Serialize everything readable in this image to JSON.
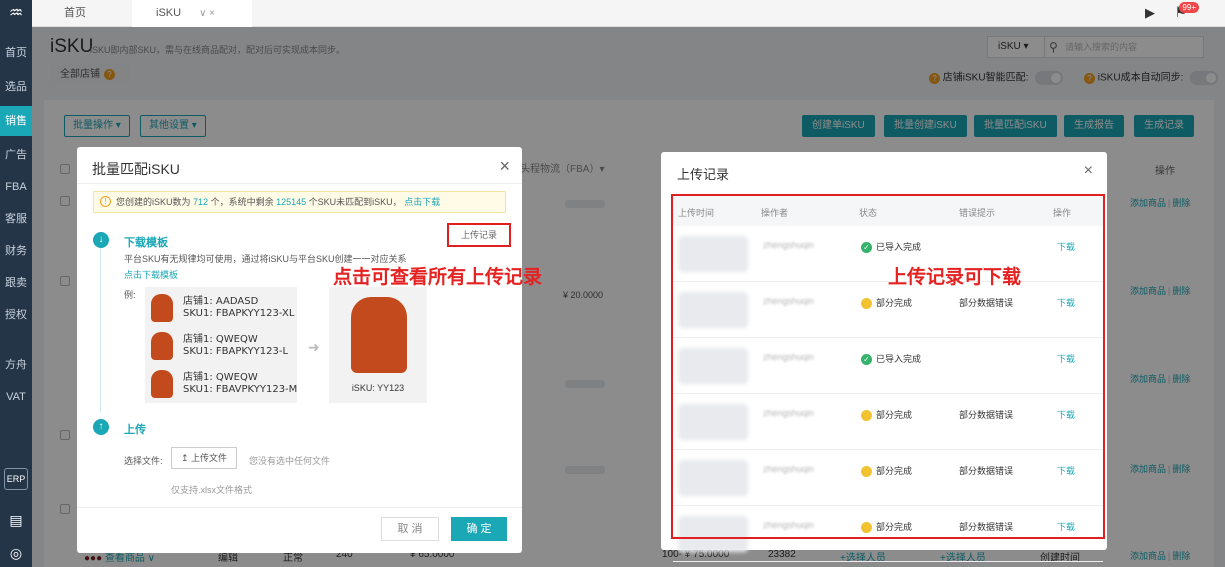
{
  "sidebar": {
    "logo": "♒",
    "items": [
      "首页",
      "选品",
      "销售",
      "广告",
      "FBA",
      "客服",
      "财务",
      "跟卖",
      "授权",
      "方舟",
      "VAT"
    ],
    "active_index": 2,
    "erp": "ERP",
    "bottom_icon_1": "▤",
    "bottom_icon_2": "◎"
  },
  "topbar": {
    "tab_home": "首页",
    "tab_isku": "iSKU",
    "tab_controls": "∨ ×",
    "play_icon": "▶",
    "bell_icon": "⚑",
    "badge": "99+"
  },
  "header": {
    "title": "iSKU",
    "description": "iSKU即内部SKU，需与在线商品配对，配对后可实现成本同步。",
    "store_select": "全部店铺",
    "search_select": "iSKU  ▾",
    "search_placeholder": "请输入搜索的内容",
    "toggle1_label": "店铺iSKU智能匹配:",
    "toggle2_label": "iSKU成本自动同步:"
  },
  "toolbar": {
    "batch_ops": "批量操作 ▾",
    "other_settings": "其他设置 ▾",
    "create_single": "创建单iSKU",
    "batch_create": "批量创建iSKU",
    "batch_match": "批量匹配iSKU",
    "gen_report": "生成报告",
    "gen_record": "生成记录"
  },
  "table_bg": {
    "col_logistics": "头程物流（FBA）▾",
    "col_op": "操作",
    "link_add": "添加商品",
    "link_delete": "删除",
    "price_partial": "¥ 20.0000",
    "bottom_view": "查看商品 ∨",
    "bottom_edit": "编辑",
    "bottom_normal": "正常",
    "bottom_qty": "240",
    "bottom_price": "¥ 65.0000",
    "bottom_range": "100- ¥ 75.0000",
    "bottom_id": "23382",
    "bottom_select1": "+选择人员",
    "bottom_select2": "+选择人员",
    "bottom_created": "创建时间"
  },
  "modal_left": {
    "title": "批量匹配iSKU",
    "notice_prefix": "您创建的iSKU数为",
    "notice_count": "712",
    "notice_mid": "个，系统中剩余",
    "notice_remaining": "125145",
    "notice_suffix": "个SKU未匹配到iSKU，",
    "notice_link": "点击下载",
    "step1_title": "下载模板",
    "upload_record": "上传记录",
    "step1_desc": "平台SKU有无规律均可使用，通过将iSKU与平台SKU创建一一对应关系",
    "download_link": "点击下载模板",
    "example_label": "例:",
    "examples": [
      {
        "store": "店铺1: AADASD",
        "sku": "SKU1: FBAPKYY123-XL"
      },
      {
        "store": "店铺1: QWEQW",
        "sku": "SKU1: FBAPKYY123-L"
      },
      {
        "store": "店铺1: QWEQW",
        "sku": "SKU1: FBAVPKYY123-M"
      }
    ],
    "result_label": "iSKU: YY123",
    "step2_title": "上传",
    "file_label": "选择文件:",
    "file_button": "上传文件",
    "file_hint": "您没有选中任何文件",
    "support_text": "仅支持.xlsx文件格式",
    "cancel": "取 消",
    "confirm": "确 定"
  },
  "annotations": {
    "left": "点击可查看所有上传记录",
    "right": "上传记录可下载"
  },
  "modal_right": {
    "title": "上传记录",
    "headers": [
      "上传时间",
      "操作者",
      "状态",
      "错误提示",
      "操作"
    ],
    "rows": [
      {
        "operator": "zhengshuqin",
        "status": "已导入完成",
        "error": "",
        "action": "下载",
        "ok": true
      },
      {
        "operator": "zhengshuqin",
        "status": "部分完成",
        "error": "部分数据错误",
        "action": "下载",
        "ok": false
      },
      {
        "operator": "zhengshuqin",
        "status": "已导入完成",
        "error": "",
        "action": "下载",
        "ok": true
      },
      {
        "operator": "zhengshuqin",
        "status": "部分完成",
        "error": "部分数据错误",
        "action": "下载",
        "ok": false
      },
      {
        "operator": "zhengshuqin",
        "status": "部分完成",
        "error": "部分数据错误",
        "action": "下载",
        "ok": false
      },
      {
        "operator": "zhengshuqin",
        "status": "部分完成",
        "error": "部分数据错误",
        "action": "下载",
        "ok": false
      }
    ]
  },
  "colors": {
    "accent": "#1aa7b6",
    "sidebar": "#243547",
    "annotation": "#e52222"
  }
}
